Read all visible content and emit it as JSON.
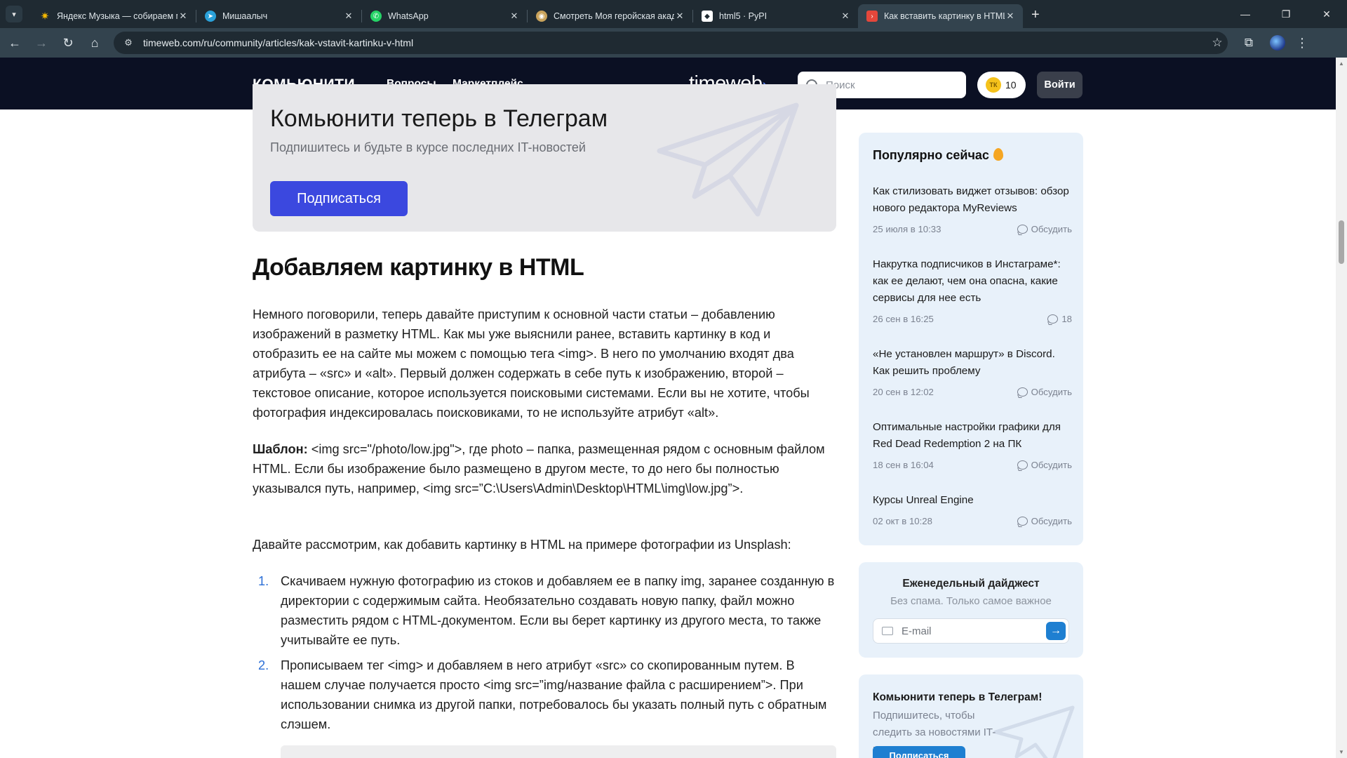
{
  "browser": {
    "tabs": [
      {
        "title": "Яндекс Музыка — собираем м",
        "icon": "yandex-music-icon",
        "color": "#f5b800"
      },
      {
        "title": "Мишаалыч",
        "icon": "telegram-icon",
        "color": "#2aa1da"
      },
      {
        "title": "WhatsApp",
        "icon": "whatsapp-icon",
        "color": "#25d366"
      },
      {
        "title": "Смотреть Моя геройская акад",
        "icon": "anime-icon",
        "color": "#c9a35c"
      },
      {
        "title": "html5 · PyPI",
        "icon": "pypi-icon",
        "color": "#ffffff"
      },
      {
        "title": "Как вставить картинку в HTML",
        "icon": "timeweb-icon",
        "color": "#e4473b"
      }
    ],
    "url": "timeweb.com/ru/community/articles/kak-vstavit-kartinku-v-html"
  },
  "header": {
    "logo": "КОМЬЮНИТИ",
    "logo_dot": ".",
    "nav": [
      "Вопросы",
      "Маркетплейс"
    ],
    "brand": "timeweb",
    "brand_chev": "›",
    "search_placeholder": "Поиск",
    "coins_label": "ТК",
    "coins": "10",
    "login": "Войти"
  },
  "banner": {
    "title": "Комьюнити теперь в Телеграм",
    "subtitle": "Подпишитесь и будьте в курсе последних IT-новостей",
    "button": "Подписаться"
  },
  "article": {
    "heading": "Добавляем картинку в HTML",
    "p1": "Немного поговорили, теперь давайте приступим к основной части статьи – добавлению изображений в разметку HTML. Как мы уже выяснили ранее, вставить картинку в код и отобразить ее на сайте мы можем с помощью тега <img>. В него по умолчанию входят два атрибута – «src» и «alt». Первый должен содержать в себе путь к изображению, второй – текстовое описание, которое используется поисковыми системами. Если вы не хотите, чтобы фотография индексировалась поисковиками, то не используйте атрибут «alt».",
    "p2_label": "Шаблон:",
    "p2": " <img src=\"/photo/low.jpg\">, где photo – папка, размещенная рядом с основным файлом HTML. Если бы изображение было размещено в другом месте, то до него бы полностью указывался путь, например, <img src=”C:\\Users\\Admin\\Desktop\\HTML\\img\\low.jpg”>.",
    "p3": "Давайте рассмотрим, как добавить картинку в HTML на примере фотографии из Unsplash:",
    "steps": [
      {
        "num": "1.",
        "text": "Скачиваем нужную фотографию из стоков и добавляем ее в папку img, заранее созданную в директории с содержимым сайта. Необязательно создавать новую папку, файл можно разместить рядом с HTML-документом. Если вы берет картинку из другого места, то также учитывайте ее путь."
      },
      {
        "num": "2.",
        "text": "Прописываем тег <img> и добавляем в него атрибут «src» со скопированным путем. В нашем случае получается просто <img src=”img/название файла с расширением”>. При использовании снимка из другой папки, потребовалось бы указать полный путь с обратным слэшем."
      }
    ]
  },
  "sidebar": {
    "popular_title": "Популярно сейчас",
    "popular": [
      {
        "title": "Как стилизовать виджет отзывов: обзор нового редактора MyReviews",
        "date": "25 июля в 10:33",
        "action": "Обсудить"
      },
      {
        "title": "Накрутка подписчиков в Инстаграме*: как ее делают, чем она опасна, какие сервисы для нее есть",
        "date": "26 сен в 16:25",
        "action": "18"
      },
      {
        "title": "«Не установлен маршрут» в Discord. Как решить проблему",
        "date": "20 сен в 12:02",
        "action": "Обсудить"
      },
      {
        "title": "Оптимальные настройки графики для Red Dead Redemption 2 на ПК",
        "date": "18 сен в 16:04",
        "action": "Обсудить"
      },
      {
        "title": "Курсы Unreal Engine",
        "date": "02 окт в 10:28",
        "action": "Обсудить"
      }
    ],
    "digest": {
      "title": "Еженедельный дайджест",
      "subtitle": "Без спама. Только самое важное",
      "email_placeholder": "E-mail"
    },
    "tg": {
      "title": "Комьюнити теперь в Телеграм!",
      "subtitle": "Подпишитесь, чтобы следить за новостями IT-индустрии",
      "button": "Подписаться"
    }
  }
}
